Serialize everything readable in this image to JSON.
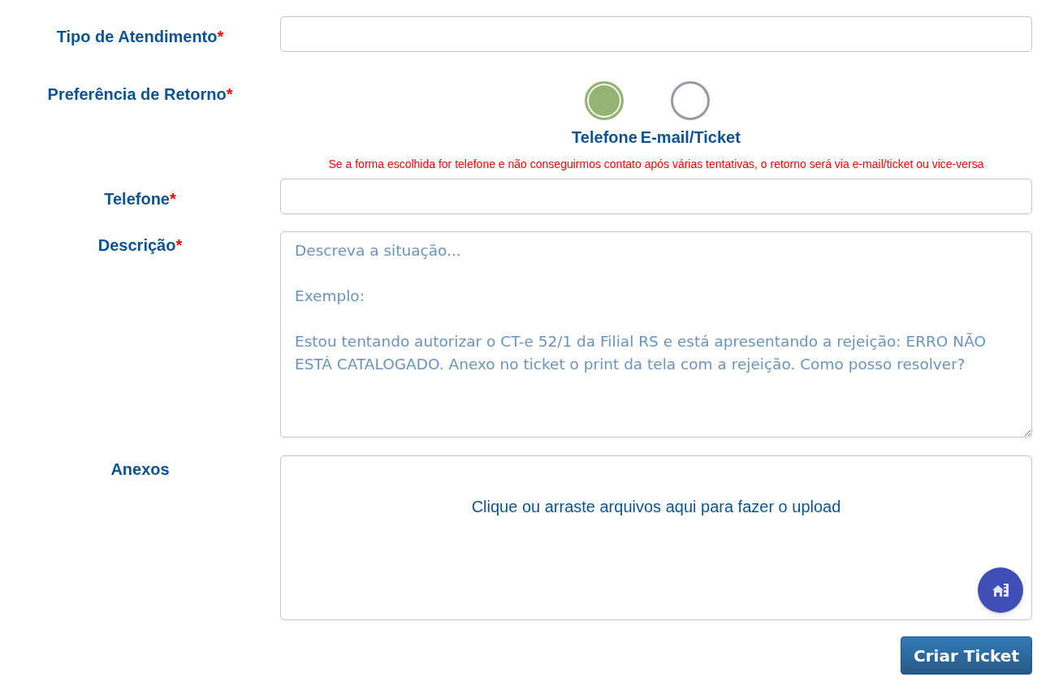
{
  "fields": [
    {
      "kind": "input",
      "label": "Tipo de Atendimento",
      "required_mark": "*"
    },
    {
      "kind": "radio",
      "label": "Preferência de Retorno",
      "required_mark": "*",
      "options": [
        {
          "label": "Telefone",
          "selected": true
        },
        {
          "label": "E-mail/Ticket",
          "selected": false
        }
      ],
      "note": "Se a forma escolhida for telefone e não conseguirmos contato após várias tentativas, o retorno será via e-mail/ticket ou vice-versa"
    },
    {
      "kind": "input",
      "label": "Telefone",
      "required_mark": "*"
    },
    {
      "kind": "textarea",
      "label": "Descrição",
      "required_mark": "*",
      "placeholder": "Descreva a situação...\n\nExemplo:\n\nEstou tentando autorizar o CT-e 52/1 da Filial RS e está apresentando a rejeição: ERRO NÃO ESTÁ CATALOGADO. Anexo no ticket o print da tela com a rejeição. Como posso resolver?"
    },
    {
      "kind": "upload",
      "label": "Anexos",
      "prompt": "Clique ou arraste arquivos aqui para fazer o upload"
    }
  ],
  "submit": "Criar Ticket"
}
